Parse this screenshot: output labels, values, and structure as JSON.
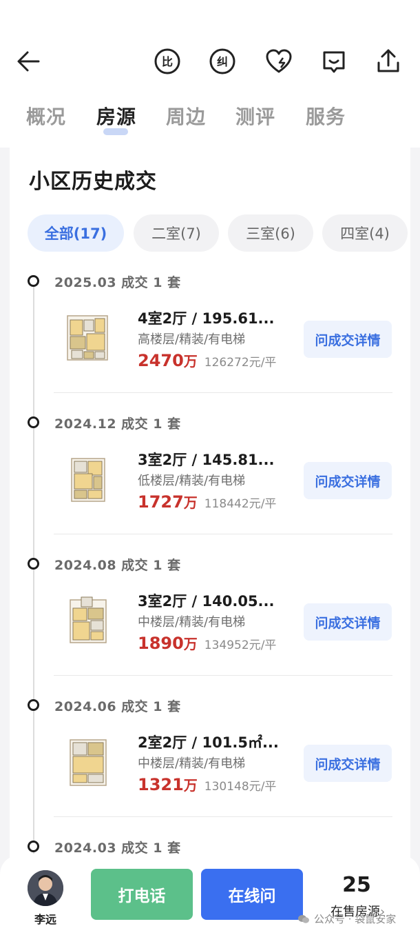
{
  "header": {
    "tabs": [
      {
        "label": "概况",
        "active": false
      },
      {
        "label": "房源",
        "active": true
      },
      {
        "label": "周边",
        "active": false
      },
      {
        "label": "测评",
        "active": false
      },
      {
        "label": "服务",
        "active": false
      }
    ],
    "actions": [
      "compare-icon",
      "correct-icon",
      "heart-icon",
      "message-icon",
      "share-icon"
    ]
  },
  "section": {
    "title": "小区历史成交",
    "filters": [
      {
        "label": "全部(17)",
        "active": true
      },
      {
        "label": "二室(7)",
        "active": false
      },
      {
        "label": "三室(6)",
        "active": false
      },
      {
        "label": "四室(4)",
        "active": false
      }
    ]
  },
  "records": [
    {
      "date": "2025.03 成交 1 套",
      "title": "4室2厅 / 195.61...",
      "desc": "高楼层/精装/有电梯",
      "price": "2470",
      "price_unit": "万",
      "unit_price": "126272元/平",
      "button": "问成交详情"
    },
    {
      "date": "2024.12 成交 1 套",
      "title": "3室2厅 / 145.81...",
      "desc": "低楼层/精装/有电梯",
      "price": "1727",
      "price_unit": "万",
      "unit_price": "118442元/平",
      "button": "问成交详情"
    },
    {
      "date": "2024.08 成交 1 套",
      "title": "3室2厅 / 140.05...",
      "desc": "中楼层/精装/有电梯",
      "price": "1890",
      "price_unit": "万",
      "unit_price": "134952元/平",
      "button": "问成交详情"
    },
    {
      "date": "2024.06 成交 1 套",
      "title": "2室2厅 / 101.5㎡...",
      "desc": "中楼层/精装/有电梯",
      "price": "1321",
      "price_unit": "万",
      "unit_price": "130148元/平",
      "button": "问成交详情"
    },
    {
      "date": "2024.03 成交 1 套"
    }
  ],
  "bottom": {
    "agent_name": "李远",
    "call_label": "打电话",
    "online_label": "在线问",
    "for_sale_count": "25",
    "for_sale_label": "在售房源",
    "watermark": "公众号 · 袋鼠安家"
  },
  "colors": {
    "accent_blue": "#3a6fe0",
    "call_green": "#5cc08a",
    "price_red": "#c8322c"
  }
}
